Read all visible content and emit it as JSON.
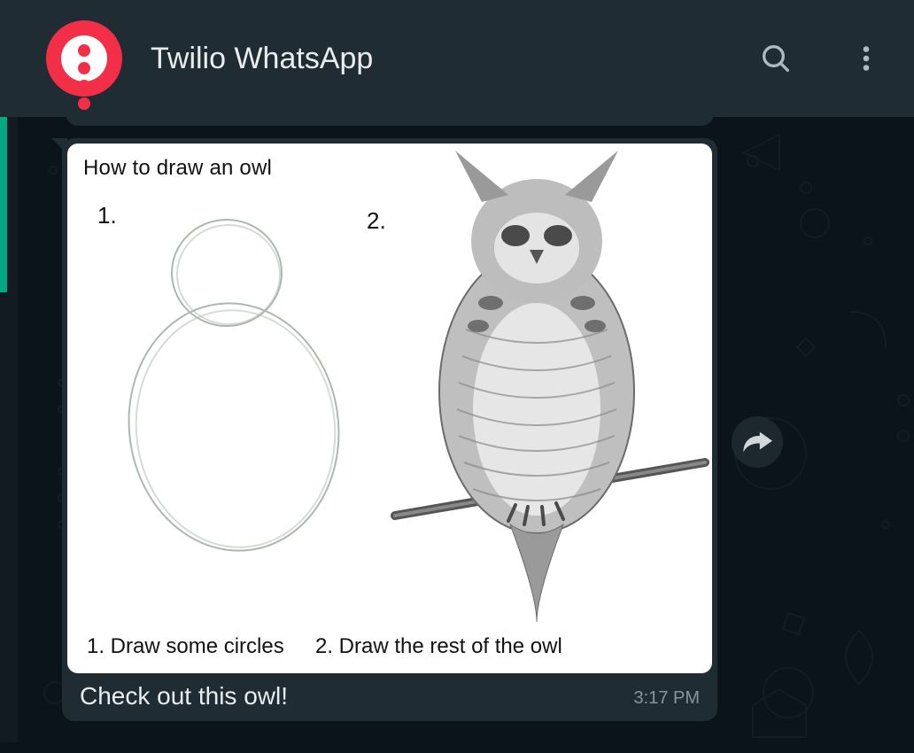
{
  "header": {
    "title": "Twilio WhatsApp",
    "icons": {
      "search": "search-icon",
      "menu": "kebab-menu-icon"
    }
  },
  "message": {
    "text": "Check out this owl!",
    "time": "3:17 PM",
    "forward_icon": "forward-icon",
    "attachment": {
      "title": "How to draw an owl",
      "step1_num": "1.",
      "step2_num": "2.",
      "caption1": "1. Draw some circles",
      "caption2": "2. Draw the rest of the owl"
    }
  }
}
